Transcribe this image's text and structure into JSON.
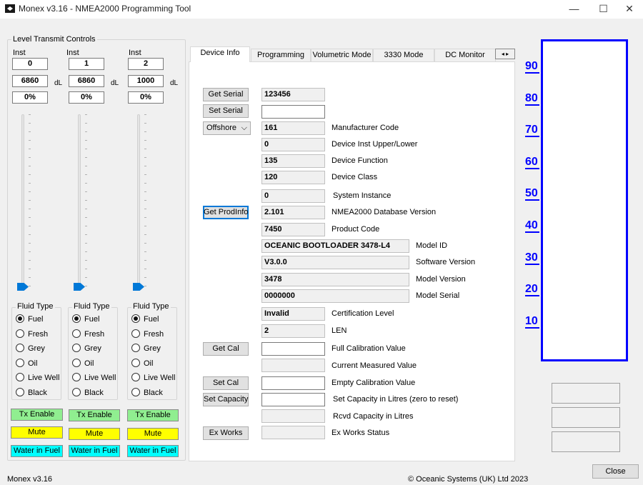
{
  "window": {
    "title": "Monex v3.16 - NMEA2000 Programming Tool",
    "minimize": "—",
    "maximize": "☐",
    "close": "✕"
  },
  "level": {
    "group_title": "Level Transmit Controls",
    "channels": [
      {
        "inst_label": "Inst",
        "inst": "0",
        "capacity": "6860",
        "unit": "dL",
        "percent": "0%",
        "level_fraction": 0
      },
      {
        "inst_label": "Inst",
        "inst": "1",
        "capacity": "6860",
        "unit": "dL",
        "percent": "0%",
        "level_fraction": 0
      },
      {
        "inst_label": "Inst",
        "inst": "2",
        "capacity": "1000",
        "unit": "dL",
        "percent": "0%",
        "level_fraction": 0
      }
    ],
    "fluid_title": "Fluid Type",
    "fluids": [
      "Fuel",
      "Fresh",
      "Grey",
      "Oil",
      "Live Well",
      "Black"
    ],
    "selected_fluid": "Fuel",
    "tx_enable": "Tx Enable",
    "mute": "Mute",
    "water_in_fuel": "Water in Fuel",
    "colors": {
      "tx_enable": "#90ee90",
      "mute": "#ffff00",
      "water_in_fuel": "#00ffff"
    }
  },
  "tabs": [
    "Device Info",
    "Programming",
    "Volumetric Mode",
    "3330 Mode",
    "DC Monitor"
  ],
  "active_tab": "Device Info",
  "device_info": {
    "get_serial": "Get Serial",
    "serial": "123456",
    "set_serial": "Set Serial",
    "set_serial_value": "",
    "region": "Offshore",
    "manufacturer_code": "161",
    "manufacturer_code_label": "Manufacturer Code",
    "device_inst": "0",
    "device_inst_label": "Device Inst Upper/Lower",
    "device_function": "135",
    "device_function_label": "Device Function",
    "device_class": "120",
    "device_class_label": "Device Class",
    "system_instance": "0",
    "system_instance_label": "System Instance",
    "get_prodinfo": "Get ProdInfo",
    "db_version": "2.101",
    "db_version_label": "NMEA2000 Database Version",
    "product_code": "7450",
    "product_code_label": "Product Code",
    "model_id": "OCEANIC BOOTLOADER 3478-L4",
    "model_id_label": "Model ID",
    "software_version": "V3.0.0",
    "software_version_label": "Software Version",
    "model_version": "3478",
    "model_version_label": "Model Version",
    "model_serial": "0000000",
    "model_serial_label": "Model Serial",
    "cert_level": "Invalid",
    "cert_level_label": "Certification Level",
    "len": "2",
    "len_label": "LEN",
    "get_cal": "Get Cal",
    "full_cal_label": "Full Calibration Value",
    "current_measured_label": "Current Measured Value",
    "set_cal": "Set Cal",
    "empty_cal_label": "Empty Calibration Value",
    "set_capacity": "Set Capacity",
    "set_capacity_label": "Set Capacity in Litres (zero to reset)",
    "rcvd_capacity_label": "Rcvd Capacity in Litres",
    "ex_works": "Ex Works",
    "ex_works_label": "Ex Works Status"
  },
  "gauge": {
    "scale": [
      "90",
      "80",
      "70",
      "60",
      "50",
      "40",
      "30",
      "20",
      "10"
    ],
    "color": "#0000ff"
  },
  "footer": {
    "version": "Monex v3.16",
    "copyright": "© Oceanic Systems (UK) Ltd 2023",
    "close": "Close"
  }
}
